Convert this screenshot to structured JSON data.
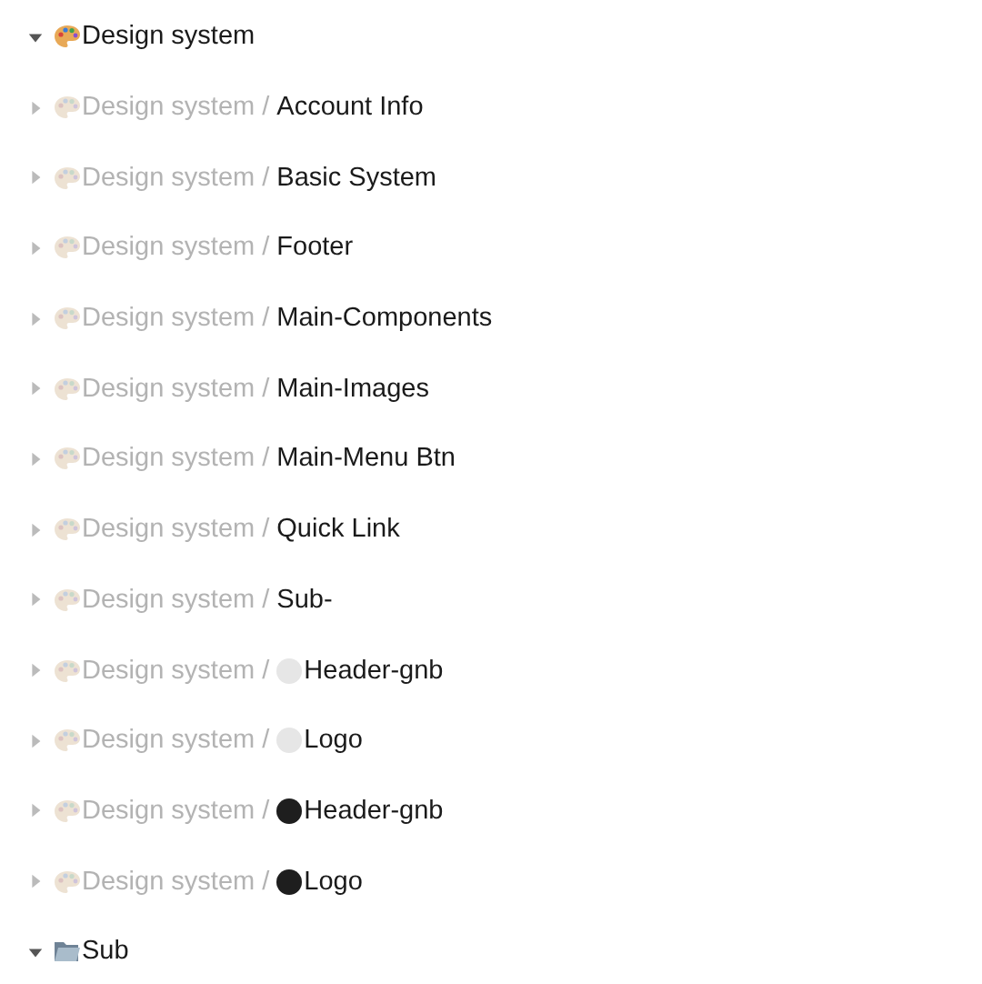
{
  "tree": [
    {
      "kind": "palette",
      "muted": false,
      "expanded": true,
      "name": "Design system"
    },
    {
      "kind": "palette",
      "muted": true,
      "expanded": false,
      "prefix": "Design system /",
      "name": "Account Info"
    },
    {
      "kind": "palette",
      "muted": true,
      "expanded": false,
      "prefix": "Design system /",
      "name": "Basic System"
    },
    {
      "kind": "palette",
      "muted": true,
      "expanded": false,
      "prefix": "Design system /",
      "name": "Footer"
    },
    {
      "kind": "palette",
      "muted": true,
      "expanded": false,
      "prefix": "Design system /",
      "name": "Main-Components"
    },
    {
      "kind": "palette",
      "muted": true,
      "expanded": false,
      "prefix": "Design system /",
      "name": "Main-Images"
    },
    {
      "kind": "palette",
      "muted": true,
      "expanded": false,
      "prefix": "Design system /",
      "name": "Main-Menu Btn"
    },
    {
      "kind": "palette",
      "muted": true,
      "expanded": false,
      "prefix": "Design system /",
      "name": "Quick Link"
    },
    {
      "kind": "palette",
      "muted": true,
      "expanded": false,
      "prefix": "Design system /",
      "name": "Sub-"
    },
    {
      "kind": "palette",
      "muted": true,
      "expanded": false,
      "prefix": "Design system /",
      "color": "#e6e6e6",
      "name": "Header-gnb"
    },
    {
      "kind": "palette",
      "muted": true,
      "expanded": false,
      "prefix": "Design system /",
      "color": "#e6e6e6",
      "name": "Logo"
    },
    {
      "kind": "palette",
      "muted": true,
      "expanded": false,
      "prefix": "Design system /",
      "color": "#1e1e1e",
      "name": "Header-gnb"
    },
    {
      "kind": "palette",
      "muted": true,
      "expanded": false,
      "prefix": "Design system /",
      "color": "#1e1e1e",
      "name": "Logo"
    },
    {
      "kind": "folder",
      "muted": false,
      "expanded": true,
      "name": "Sub"
    }
  ]
}
